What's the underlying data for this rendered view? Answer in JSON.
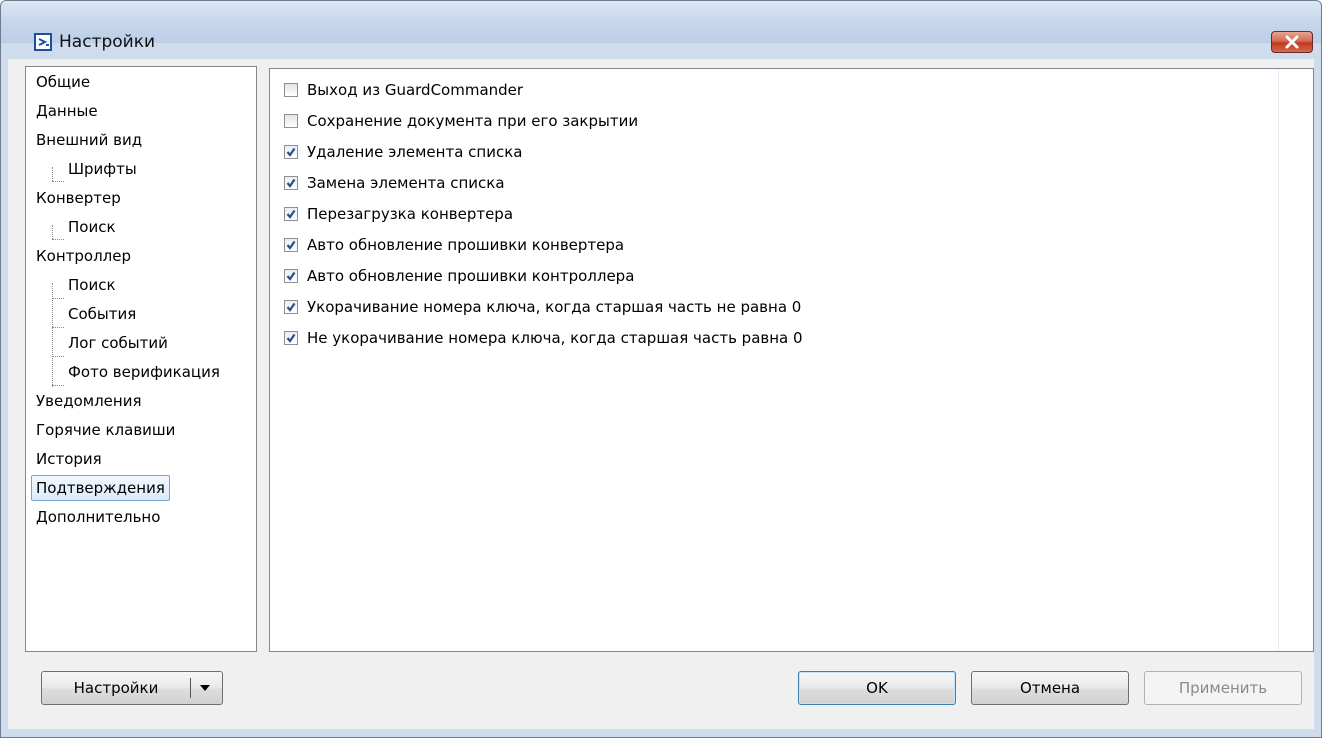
{
  "window": {
    "title": "Настройки"
  },
  "nav": {
    "items": [
      {
        "label": "Общие"
      },
      {
        "label": "Данные"
      },
      {
        "label": "Внешний вид"
      },
      {
        "label": "Шрифты"
      },
      {
        "label": "Конвертер"
      },
      {
        "label": "Поиск"
      },
      {
        "label": "Контроллер"
      },
      {
        "label": "Поиск"
      },
      {
        "label": "События"
      },
      {
        "label": "Лог событий"
      },
      {
        "label": "Фото верификация"
      },
      {
        "label": "Уведомления"
      },
      {
        "label": "Горячие клавиши"
      },
      {
        "label": "История"
      },
      {
        "label": "Подтверждения"
      },
      {
        "label": "Дополнительно"
      }
    ],
    "selected": "Подтверждения"
  },
  "options": [
    {
      "label": "Выход из GuardCommander",
      "checked": false
    },
    {
      "label": "Сохранение документа при его закрытии",
      "checked": false
    },
    {
      "label": "Удаление элемента списка",
      "checked": true
    },
    {
      "label": "Замена элемента списка",
      "checked": true
    },
    {
      "label": "Перезагрузка конвертера",
      "checked": true
    },
    {
      "label": "Авто обновление прошивки конвертера",
      "checked": true
    },
    {
      "label": "Авто обновление прошивки контроллера",
      "checked": true
    },
    {
      "label": "Укорачивание номера ключа, когда старшая часть не равна 0",
      "checked": true
    },
    {
      "label": "Не укорачивание номера ключа, когда старшая часть равна 0",
      "checked": true
    }
  ],
  "footer": {
    "settings_label": "Настройки",
    "ok_label": "OK",
    "cancel_label": "Отмена",
    "apply_label": "Применить",
    "apply_enabled": false
  }
}
